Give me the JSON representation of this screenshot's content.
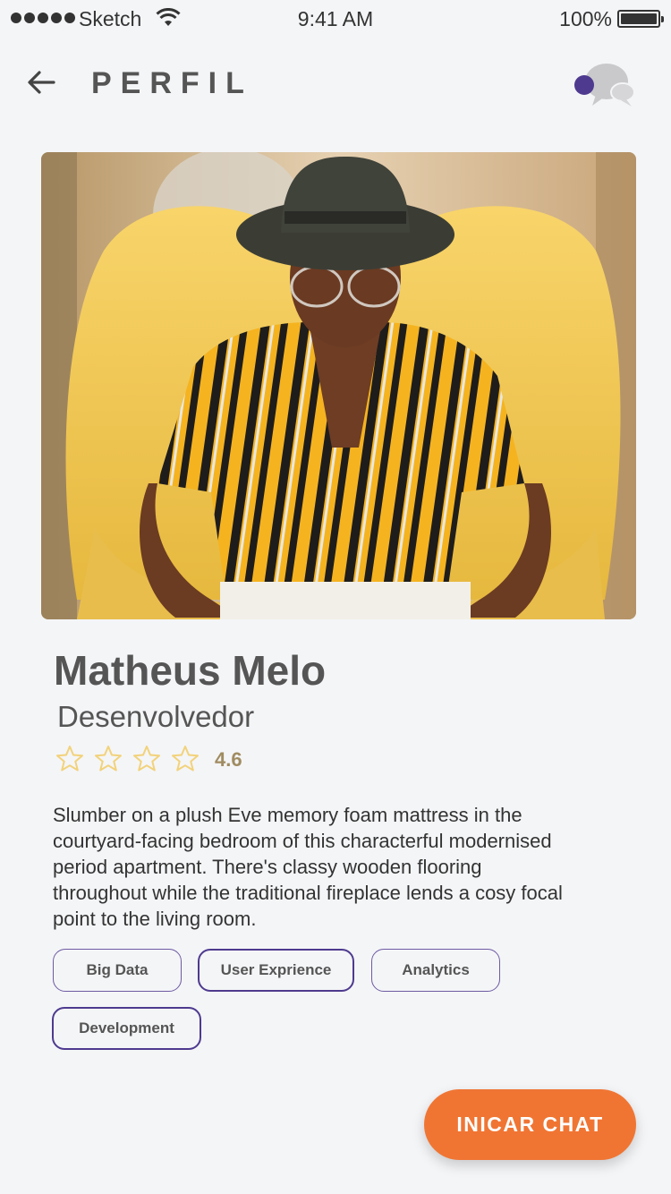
{
  "status_bar": {
    "carrier": "Sketch",
    "time": "9:41 AM",
    "battery": "100%"
  },
  "header": {
    "title": "PERFIL",
    "back_icon": "arrow-left-icon",
    "chat_icon": "chat-bubbles-icon",
    "notification_color": "#4e3a8f"
  },
  "profile": {
    "name": "Matheus Melo",
    "role": "Desenvolvedor",
    "rating": {
      "value": "4.6",
      "stars_total": 4,
      "star_color": "#f2d27a",
      "value_color": "#a08c61"
    },
    "bio": "Slumber on a plush Eve memory foam mattress in the courtyard-facing bedroom of this characterful modernised period apartment. There's classy wooden flooring throughout while the traditional fireplace lends a cosy focal point to the living room."
  },
  "tags": [
    {
      "label": "Big Data",
      "selected": false
    },
    {
      "label": "User Exprience",
      "selected": true
    },
    {
      "label": "Analytics",
      "selected": false
    },
    {
      "label": "Development",
      "selected": true
    }
  ],
  "cta": {
    "label": "INICAR CHAT",
    "color": "#f07533"
  },
  "colors": {
    "background": "#f4f5f7",
    "accent": "#4e3a8f",
    "text": "#555555"
  }
}
